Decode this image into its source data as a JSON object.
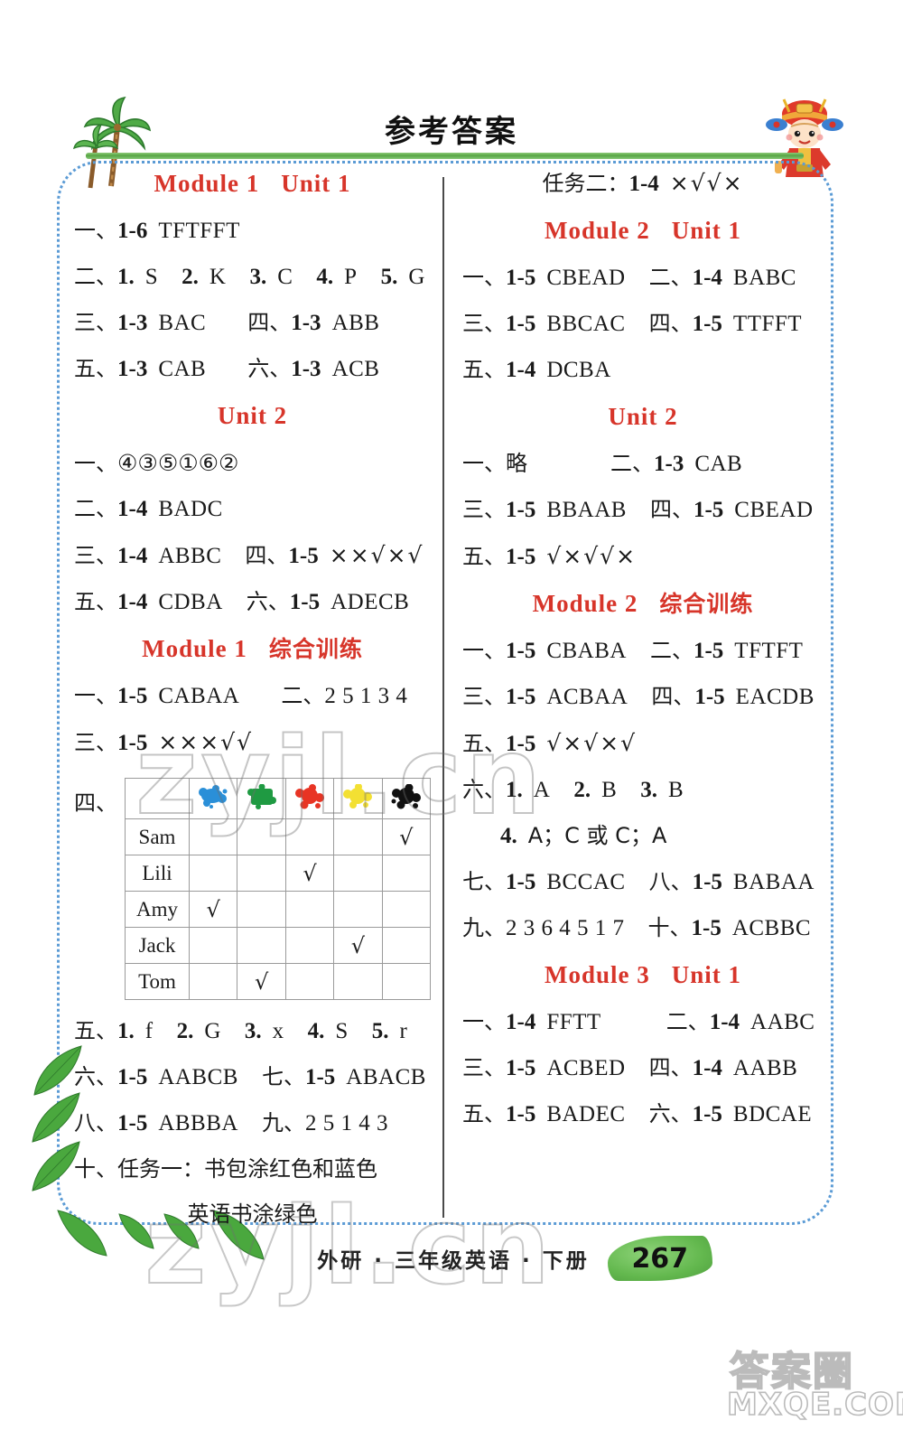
{
  "header": {
    "title": "参考答案",
    "palm_icon": "palm-tree-icon",
    "mascot_icon": "chinese-opera-child-icon"
  },
  "left_column": {
    "sections": [
      {
        "heading": {
          "module": "Module 1",
          "unit": "Unit 1"
        },
        "lines": [
          [
            {
              "cn": "一、",
              "num": "1-6",
              "ans": "TFTFFT"
            }
          ],
          [
            {
              "cn": "二、",
              "num": "1.",
              "ans": "S"
            },
            {
              "num": "2.",
              "ans": "K"
            },
            {
              "num": "3.",
              "ans": "C"
            },
            {
              "num": "4.",
              "ans": "P"
            },
            {
              "num": "5.",
              "ans": "G"
            }
          ],
          [
            {
              "cn": "三、",
              "num": "1-3",
              "ans": "BAC"
            },
            {
              "cn": "四、",
              "num": "1-3",
              "ans": "ABB"
            }
          ],
          [
            {
              "cn": "五、",
              "num": "1-3",
              "ans": "CAB"
            },
            {
              "cn": "六、",
              "num": "1-3",
              "ans": "ACB"
            }
          ]
        ]
      },
      {
        "heading": {
          "module": "",
          "unit": "Unit 2"
        },
        "lines": [
          [
            {
              "cn": "一、",
              "num": "",
              "ans": "④③⑤①⑥②"
            }
          ],
          [
            {
              "cn": "二、",
              "num": "1-4",
              "ans": "BADC"
            }
          ],
          [
            {
              "cn": "三、",
              "num": "1-4",
              "ans": "ABBC"
            },
            {
              "cn": "四、",
              "num": "1-5",
              "ans": "××√×√"
            }
          ],
          [
            {
              "cn": "五、",
              "num": "1-4",
              "ans": "CDBA"
            },
            {
              "cn": "六、",
              "num": "1-5",
              "ans": "ADECB"
            }
          ]
        ]
      },
      {
        "heading": {
          "module": "Module 1",
          "unit_cn": "综合训练"
        },
        "lines": [
          [
            {
              "cn": "一、",
              "num": "1-5",
              "ans": "CABAA"
            },
            {
              "cn": "二、",
              "num": "",
              "ans": "2 5 1 3 4"
            }
          ],
          [
            {
              "cn": "三、",
              "num": "1-5",
              "ans": "×××√√"
            }
          ]
        ],
        "table": {
          "label_cn": "四、",
          "columns": [
            {
              "name": "blue-paint-splat-icon",
              "color": "#2a8fd8"
            },
            {
              "name": "green-paint-splat-icon",
              "color": "#1f9a42"
            },
            {
              "name": "red-paint-splat-icon",
              "color": "#e83424"
            },
            {
              "name": "yellow-paint-splat-icon",
              "color": "#f3e033"
            },
            {
              "name": "black-paint-splat-icon",
              "color": "#111111"
            }
          ],
          "rows": [
            {
              "name": "Sam",
              "checks": [
                false,
                false,
                false,
                false,
                true
              ]
            },
            {
              "name": "Lili",
              "checks": [
                false,
                false,
                true,
                false,
                false
              ]
            },
            {
              "name": "Amy",
              "checks": [
                true,
                false,
                false,
                false,
                false
              ]
            },
            {
              "name": "Jack",
              "checks": [
                false,
                false,
                false,
                true,
                false
              ]
            },
            {
              "name": "Tom",
              "checks": [
                false,
                true,
                false,
                false,
                false
              ]
            }
          ],
          "check_mark": "√"
        },
        "lines_after": [
          [
            {
              "cn": "五、",
              "num": "1.",
              "ans": "f"
            },
            {
              "num": "2.",
              "ans": "G"
            },
            {
              "num": "3.",
              "ans": "x"
            },
            {
              "num": "4.",
              "ans": "S"
            },
            {
              "num": "5.",
              "ans": "r"
            }
          ],
          [
            {
              "cn": "六、",
              "num": "1-5",
              "ans": "AABCB"
            },
            {
              "cn": "七、",
              "num": "1-5",
              "ans": "ABACB"
            }
          ],
          [
            {
              "cn": "八、",
              "num": "1-5",
              "ans": "ABBBA"
            },
            {
              "cn": "九、",
              "num": "",
              "ans": "2 5 1 4 3"
            }
          ]
        ],
        "task_lines": [
          "十、任务一：书包涂红色和蓝色",
          "英语书涂绿色"
        ]
      }
    ]
  },
  "right_column": {
    "top_line": {
      "cn": "任务二：",
      "num": "1-4",
      "ans": "×√√×"
    },
    "sections": [
      {
        "heading": {
          "module": "Module 2",
          "unit": "Unit 1"
        },
        "lines": [
          [
            {
              "cn": "一、",
              "num": "1-5",
              "ans": "CBEAD"
            },
            {
              "cn": "二、",
              "num": "1-4",
              "ans": "BABC"
            }
          ],
          [
            {
              "cn": "三、",
              "num": "1-5",
              "ans": "BBCAC"
            },
            {
              "cn": "四、",
              "num": "1-5",
              "ans": "TTFFT"
            }
          ],
          [
            {
              "cn": "五、",
              "num": "1-4",
              "ans": "DCBA"
            }
          ]
        ]
      },
      {
        "heading": {
          "module": "",
          "unit": "Unit 2"
        },
        "lines": [
          [
            {
              "cn": "一、",
              "num": "",
              "ans": "略"
            },
            {
              "cn": "二、",
              "num": "1-3",
              "ans": "CAB"
            }
          ],
          [
            {
              "cn": "三、",
              "num": "1-5",
              "ans": "BBAAB"
            },
            {
              "cn": "四、",
              "num": "1-5",
              "ans": "CBEAD"
            }
          ],
          [
            {
              "cn": "五、",
              "num": "1-5",
              "ans": "√×√√×"
            }
          ]
        ]
      },
      {
        "heading": {
          "module": "Module 2",
          "unit_cn": "综合训练"
        },
        "lines": [
          [
            {
              "cn": "一、",
              "num": "1-5",
              "ans": "CBABA"
            },
            {
              "cn": "二、",
              "num": "1-5",
              "ans": "TFTFT"
            }
          ],
          [
            {
              "cn": "三、",
              "num": "1-5",
              "ans": "ACBAA"
            },
            {
              "cn": "四、",
              "num": "1-5",
              "ans": "EACDB"
            }
          ],
          [
            {
              "cn": "五、",
              "num": "1-5",
              "ans": "√×√×√"
            }
          ],
          [
            {
              "cn": "六、",
              "num": "1.",
              "ans": "A"
            },
            {
              "num": "2.",
              "ans": "B"
            },
            {
              "num": "3.",
              "ans": "B"
            }
          ],
          [
            {
              "cn": "",
              "num": "4.",
              "ans": "A；C 或 C；A",
              "indent": true
            }
          ],
          [
            {
              "cn": "七、",
              "num": "1-5",
              "ans": "BCCAC"
            },
            {
              "cn": "八、",
              "num": "1-5",
              "ans": "BABAA"
            }
          ],
          [
            {
              "cn": "九、",
              "num": "",
              "ans": "2 3 6 4 5 1 7"
            },
            {
              "cn": "十、",
              "num": "1-5",
              "ans": "ACBBC"
            }
          ]
        ]
      },
      {
        "heading": {
          "module": "Module 3",
          "unit": "Unit 1"
        },
        "lines": [
          [
            {
              "cn": "一、",
              "num": "1-4",
              "ans": "FFTT"
            },
            {
              "cn": "二、",
              "num": "1-4",
              "ans": "AABC"
            }
          ],
          [
            {
              "cn": "三、",
              "num": "1-5",
              "ans": "ACBED"
            },
            {
              "cn": "四、",
              "num": "1-4",
              "ans": "AABB"
            }
          ],
          [
            {
              "cn": "五、",
              "num": "1-5",
              "ans": "BADEC"
            },
            {
              "cn": "六、",
              "num": "1-5",
              "ans": "BDCAE"
            }
          ]
        ]
      }
    ]
  },
  "footer": {
    "text": "外研 · 三年级英语 · 下册",
    "page_number": "267"
  },
  "watermarks": {
    "mid": "zyjl.cn",
    "low": "zyjl.cn",
    "brand_cn": "答案圈",
    "brand_url": "MXQE.COM"
  },
  "colors": {
    "heading_red": "#d7352a",
    "rule_green": "#57a544",
    "frame_blue": "#5b9bd5"
  }
}
